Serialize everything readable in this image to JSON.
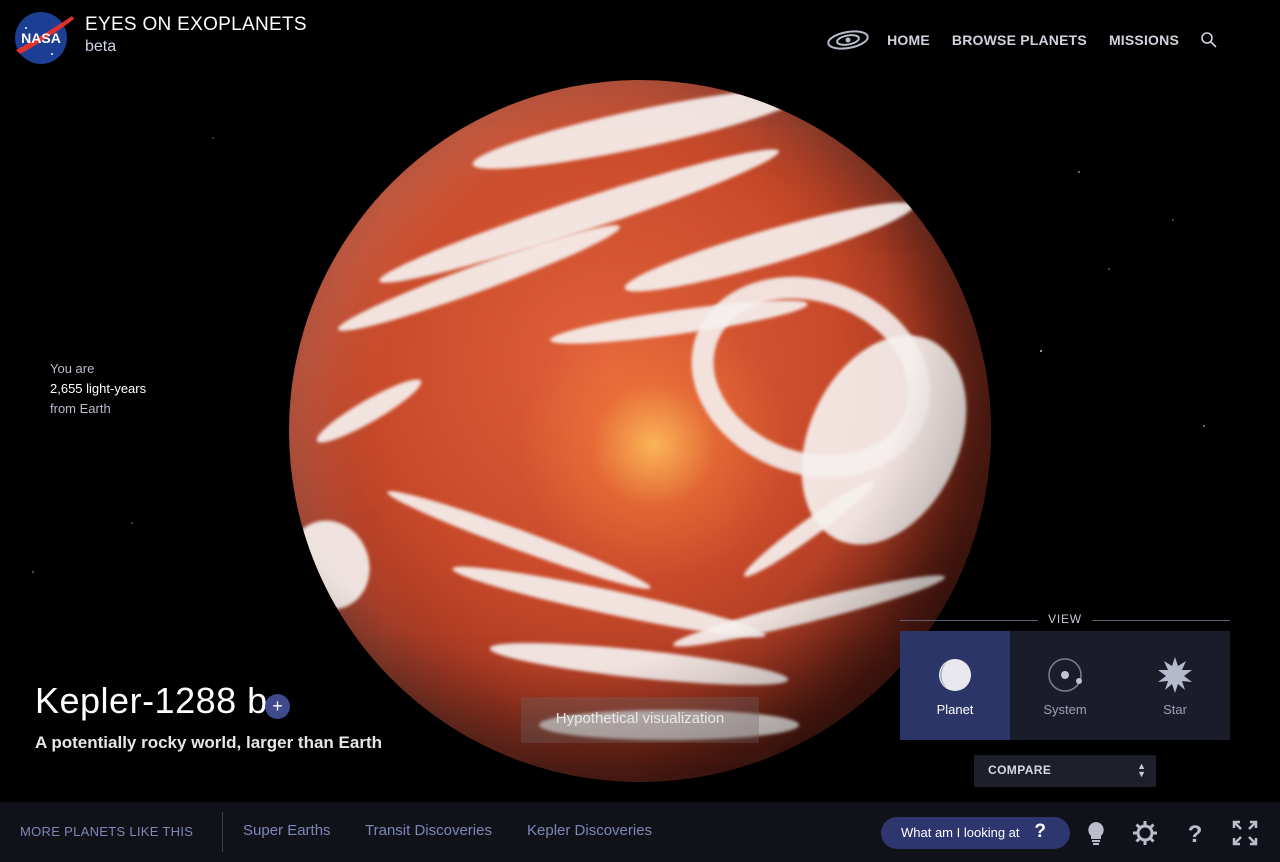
{
  "header": {
    "logo_alt": "NASA",
    "title": "EYES ON EXOPLANETS",
    "subtitle": "beta",
    "nav": [
      {
        "label": "HOME"
      },
      {
        "label": "BROWSE PLANETS"
      },
      {
        "label": "MISSIONS"
      }
    ]
  },
  "distance": {
    "prefix": "You are",
    "value": "2,655 light-years",
    "suffix": "from Earth"
  },
  "planet": {
    "name": "Kepler-1288 b",
    "description": "A potentially rocky world, larger than Earth",
    "plus_label": "+",
    "visualization_note": "Hypothetical visualization"
  },
  "view": {
    "title": "VIEW",
    "options": [
      {
        "label": "Planet",
        "icon": "planet-icon",
        "active": true
      },
      {
        "label": "System",
        "icon": "system-icon",
        "active": false
      },
      {
        "label": "Star",
        "icon": "star-icon",
        "active": false
      }
    ],
    "compare_label": "COMPARE"
  },
  "bottom_bar": {
    "more_label": "MORE PLANETS LIKE THIS",
    "tags": [
      "Super Earths",
      "Transit Discoveries",
      "Kepler Discoveries"
    ],
    "what_am_i_label": "What am I looking at",
    "what_am_i_icon": "?"
  },
  "colors": {
    "accent": "#2e3670",
    "active_view": "#2c3568",
    "link": "#7f87b8"
  }
}
